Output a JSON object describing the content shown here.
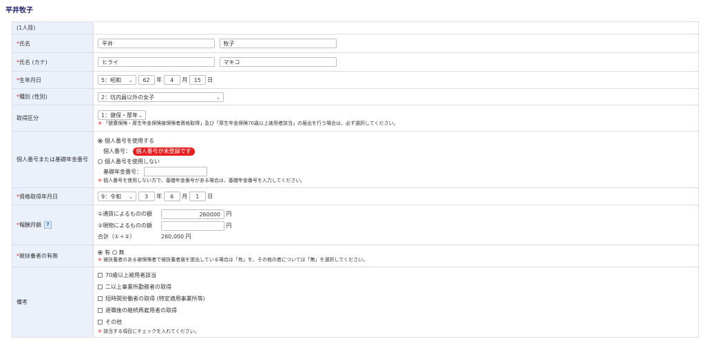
{
  "title": "平井牧子",
  "person_count": "(1人目)",
  "name": {
    "label": "氏名",
    "last": "平井",
    "first": "牧子"
  },
  "kana": {
    "label": "氏名 (カナ)",
    "last": "ヒライ",
    "first": "マキコ"
  },
  "birth": {
    "label": "生年月日",
    "era": "5：昭和",
    "year": "62",
    "year_unit": "年",
    "month": "4",
    "month_unit": "月",
    "day": "15",
    "day_unit": "日"
  },
  "kind": {
    "label": "種別 (性別)",
    "value": "2：坑内員以外の女子"
  },
  "acquisition": {
    "label": "取得区分",
    "value": "1：健保・厚年",
    "note_mark": "※",
    "note": "「健康保険・厚生年金保険被保険者資格取得」及び「厚生年金保険70歳以上被用者該当」の届出を行う場合は、必ず選択してください。"
  },
  "mynumber": {
    "label": "個人番号または基礎年金番号",
    "use_label": "個人番号を使用する",
    "num_label": "個人番号：",
    "badge": "個人番号が未登録です",
    "nouse_label": "個人番号を使用しない",
    "pension_label": "基礎年金番号：",
    "pension_value": "",
    "note_mark": "※",
    "note": "個人番号を使用しない方で、基礎年金番号がある場合は、基礎年金番号を入力してください。"
  },
  "qualdate": {
    "label": "資格取得年月日",
    "era": "9：令和",
    "year": "3",
    "year_unit": "年",
    "month": "6",
    "month_unit": "月",
    "day": "1",
    "day_unit": "日"
  },
  "salary": {
    "label": "報酬月額",
    "help": "?",
    "cash_label": "①通貨によるものの額",
    "cash_value": "260000",
    "unit": "円",
    "kind_label": "②現物によるものの額",
    "kind_value": "",
    "total_label": "合計（①＋②）",
    "total_value": "260,000 円"
  },
  "dependents": {
    "label": "被扶養者の有無",
    "yes": "有",
    "no": "無",
    "note_mark": "※",
    "note": "被扶養者のある被保険者で被扶養者届を提出している場合は「有」を、その他の者については「無」を選択してください。"
  },
  "remarks": {
    "label": "備考",
    "items": [
      "70歳以上被用者該当",
      "二以上事業所勤務者の取得",
      "短時間労働者の取得 (特定適用事業所等)",
      "退職後の継続再雇用者の取得",
      "その他"
    ],
    "note_mark": "※",
    "note": "該当する項目にチェックを入れてください。"
  },
  "req_mark": "*"
}
